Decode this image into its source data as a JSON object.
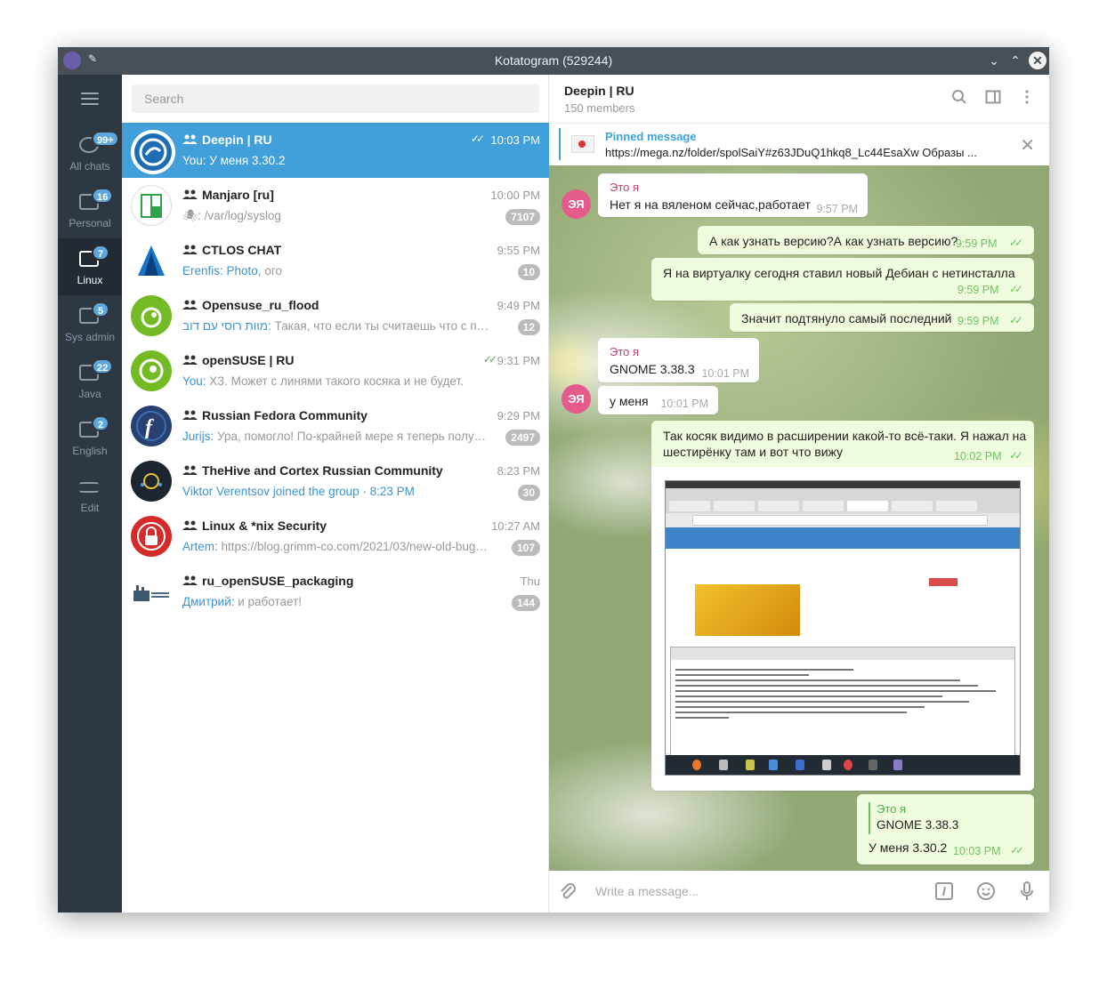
{
  "window": {
    "title": "Kotatogram (529244)"
  },
  "folders": [
    {
      "label": "All chats",
      "badge": "99+"
    },
    {
      "label": "Personal",
      "badge": "16"
    },
    {
      "label": "Linux",
      "badge": "7"
    },
    {
      "label": "Sys admin",
      "badge": "5"
    },
    {
      "label": "Java",
      "badge": "22"
    },
    {
      "label": "English",
      "badge": "2"
    },
    {
      "label": "Edit"
    }
  ],
  "search": {
    "placeholder": "Search"
  },
  "chats": [
    {
      "name": "Deepin | RU",
      "time": "10:03 PM",
      "preview": "You: У меня 3.30.2",
      "read": true
    },
    {
      "name": "Manjaro [ru]",
      "time": "10:00 PM",
      "preview": "🕷: /var/log/syslog",
      "unread": "7107"
    },
    {
      "name": "CTLOS CHAT",
      "time": "9:55 PM",
      "from": "Erenfis: Photo,",
      "preview": " ого",
      "unread": "10"
    },
    {
      "name": "Opensuse_ru_flood",
      "time": "9:49 PM",
      "from": "מוות רוסי עם דוב:",
      "preview": " Такая, что если ты считаешь что с прибо...",
      "unread": "12"
    },
    {
      "name": "openSUSE | RU",
      "time": "9:31 PM",
      "from": "You:",
      "preview": " ХЗ. Может с линями такого косяка и не будет.",
      "read": true
    },
    {
      "name": "Russian Fedora Community",
      "time": "9:29 PM",
      "from": "Jurijs:",
      "preview": " Ура, помогло! По-крайней мере я теперь получи...",
      "unread": "2497"
    },
    {
      "name": "TheHive and Cortex Russian Community",
      "time": "8:23 PM",
      "from": "Viktor Verentsov joined the group · 8:23 PM",
      "preview": "",
      "unread": "30"
    },
    {
      "name": "Linux & *nix Security",
      "time": "10:27 AM",
      "from": "Artem:",
      "preview": " https://blog.grimm-co.com/2021/03/new-old-bugs-i...",
      "unread": "107"
    },
    {
      "name": "ru_openSUSE_packaging",
      "time": "Thu",
      "from": "Дмитрий:",
      "preview": " и работает!",
      "unread": "144"
    }
  ],
  "header": {
    "title": "Deepin | RU",
    "subtitle": "150 members"
  },
  "pinned": {
    "label": "Pinned message",
    "text": "https://mega.nz/folder/spolSaiY#z63JDuQ1hkq8_Lc44EsaXw  Образы ..."
  },
  "messages": [
    {
      "sender": "Это я",
      "text": "Нет я на вяленом сейчас,работает",
      "time": "9:57 PM",
      "avatar": "ЭЯ"
    },
    {
      "text": "А как узнать версию?А как узнать версию?",
      "time": "9:59 PM"
    },
    {
      "text": "Я на виртуалку сегодня ставил новый Дебиан с нетинсталла",
      "time": "9:59 PM"
    },
    {
      "text": "Значит подтянуло самый последний",
      "time": "9:59 PM"
    },
    {
      "sender": "Это я",
      "text": "GNOME 3.38.3",
      "time": "10:01 PM"
    },
    {
      "text": "у меня",
      "time": "10:01 PM",
      "avatar": "ЭЯ"
    },
    {
      "text_line1": "Так косяк видимо в расширении какой-то всё-таки. Я нажал на",
      "text_line2": "шестирёнку там и вот что вижу",
      "time": "10:02 PM"
    },
    {
      "reply_sender": "Это я",
      "reply_text": "GNOME 3.38.3",
      "text": "У меня 3.30.2",
      "time": "10:03 PM"
    }
  ],
  "composer": {
    "placeholder": "Write a message..."
  },
  "colors": {
    "accent": "#419fd9",
    "sidebar": "#2e3842",
    "outgoing": "#effdde",
    "sender": "#c03d73"
  }
}
